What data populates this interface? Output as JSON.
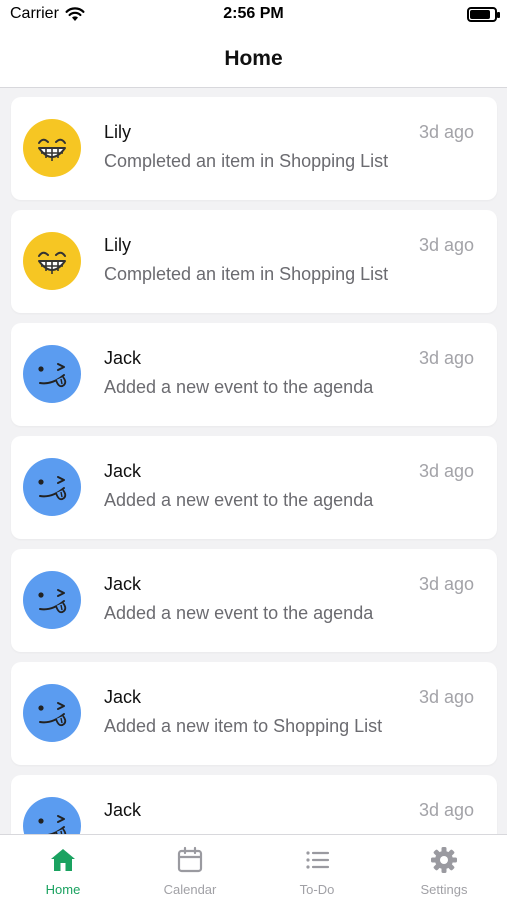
{
  "status_bar": {
    "carrier": "Carrier",
    "time": "2:56 PM",
    "battery_level": 0.85
  },
  "header": {
    "title": "Home"
  },
  "feed": [
    {
      "name": "Lily",
      "time": "3d ago",
      "text": "Completed an item in Shopping List",
      "avatar": "grinning-face-icon",
      "color": "#f6c623"
    },
    {
      "name": "Lily",
      "time": "3d ago",
      "text": "Completed an item in Shopping List",
      "avatar": "grinning-face-icon",
      "color": "#f6c623"
    },
    {
      "name": "Jack",
      "time": "3d ago",
      "text": "Added a new event to the agenda",
      "avatar": "winking-tongue-face-icon",
      "color": "#5b9cf0"
    },
    {
      "name": "Jack",
      "time": "3d ago",
      "text": "Added a new event to the agenda",
      "avatar": "winking-tongue-face-icon",
      "color": "#5b9cf0"
    },
    {
      "name": "Jack",
      "time": "3d ago",
      "text": "Added a new event to the agenda",
      "avatar": "winking-tongue-face-icon",
      "color": "#5b9cf0"
    },
    {
      "name": "Jack",
      "time": "3d ago",
      "text": "Added a new item to Shopping List",
      "avatar": "winking-tongue-face-icon",
      "color": "#5b9cf0"
    },
    {
      "name": "Jack",
      "time": "3d ago",
      "text": "",
      "avatar": "winking-tongue-face-icon",
      "color": "#5b9cf0"
    }
  ],
  "tabs": [
    {
      "label": "Home",
      "icon": "home-icon",
      "active": true
    },
    {
      "label": "Calendar",
      "icon": "calendar-icon",
      "active": false
    },
    {
      "label": "To-Do",
      "icon": "list-icon",
      "active": false
    },
    {
      "label": "Settings",
      "icon": "gear-icon",
      "active": false
    }
  ],
  "colors": {
    "accent": "#1aa260",
    "inactive": "#a1a1a6"
  }
}
